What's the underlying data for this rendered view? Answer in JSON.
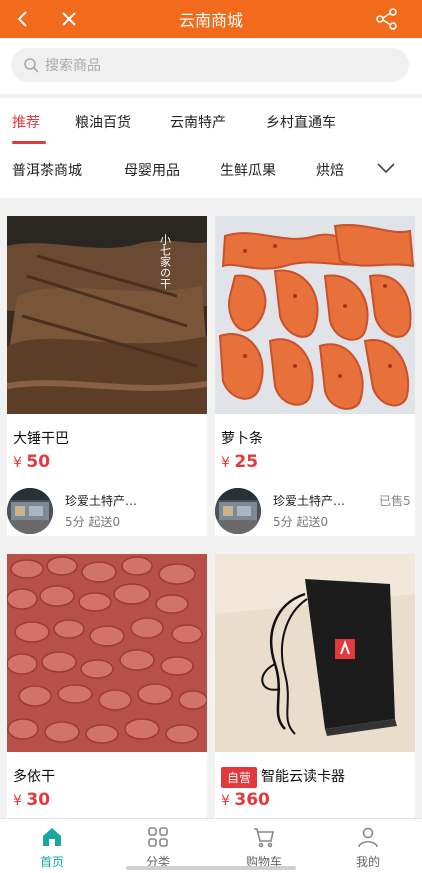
{
  "header": {
    "title": "云南商城",
    "back_icon": "back-arrow-icon",
    "close_icon": "close-icon",
    "share_icon": "share-icon"
  },
  "search": {
    "placeholder": "搜索商品",
    "icon": "search-icon"
  },
  "tabs": {
    "row1": [
      "推荐",
      "粮油百货",
      "云南特产",
      "乡村直通车"
    ],
    "row2": [
      "普洱茶商城",
      "母婴用品",
      "生鲜瓜果",
      "烘焙"
    ],
    "expand_icon": "chevron-down-icon"
  },
  "products": [
    {
      "name": "大锤干巴",
      "currency": "¥",
      "price": "50",
      "shop": "珍爱土特产…",
      "meta": "5分 起送0",
      "sold": "",
      "image_caption": "小七家の干"
    },
    {
      "name": "萝卜条",
      "currency": "¥",
      "price": "25",
      "shop": "珍爱土特产…",
      "meta": "5分 起送0",
      "sold": "已售5"
    },
    {
      "name": "多依干",
      "currency": "¥",
      "price": "30"
    },
    {
      "name": "智能云读卡器",
      "badge": "自营",
      "currency": "¥",
      "price": "360"
    }
  ],
  "tabbar": [
    {
      "label": "首页",
      "icon": "home-icon"
    },
    {
      "label": "分类",
      "icon": "category-icon"
    },
    {
      "label": "购物车",
      "icon": "cart-icon"
    },
    {
      "label": "我的",
      "icon": "profile-icon"
    }
  ],
  "colors": {
    "header": "#f26a1b",
    "accent": "#e4393c",
    "tab_active": "#18a8a0"
  }
}
